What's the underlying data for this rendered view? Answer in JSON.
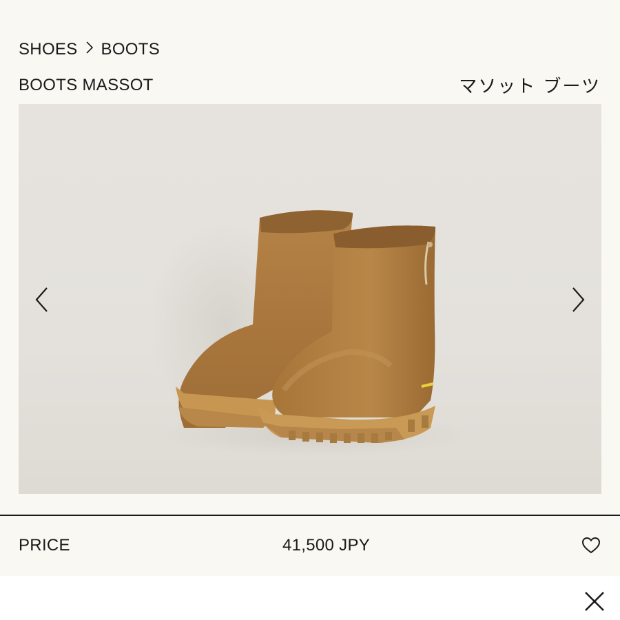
{
  "breadcrumb": {
    "items": [
      "SHOES",
      "BOOTS"
    ],
    "separator": "chevron-right-icon"
  },
  "product": {
    "name": "BOOTS MASSOT",
    "name_ja": "マソット ブーツ",
    "image_alt": "boots-photo",
    "image_colors": {
      "background": "#e4e1dc",
      "suede": "#b07c42",
      "sole": "#c99a55"
    }
  },
  "gallery": {
    "prev_icon": "chevron-left-icon",
    "next_icon": "chevron-right-icon"
  },
  "price": {
    "label": "PRICE",
    "value": "41,500 JPY",
    "favorite_icon": "heart-icon"
  },
  "bottom": {
    "close_icon": "close-icon"
  }
}
